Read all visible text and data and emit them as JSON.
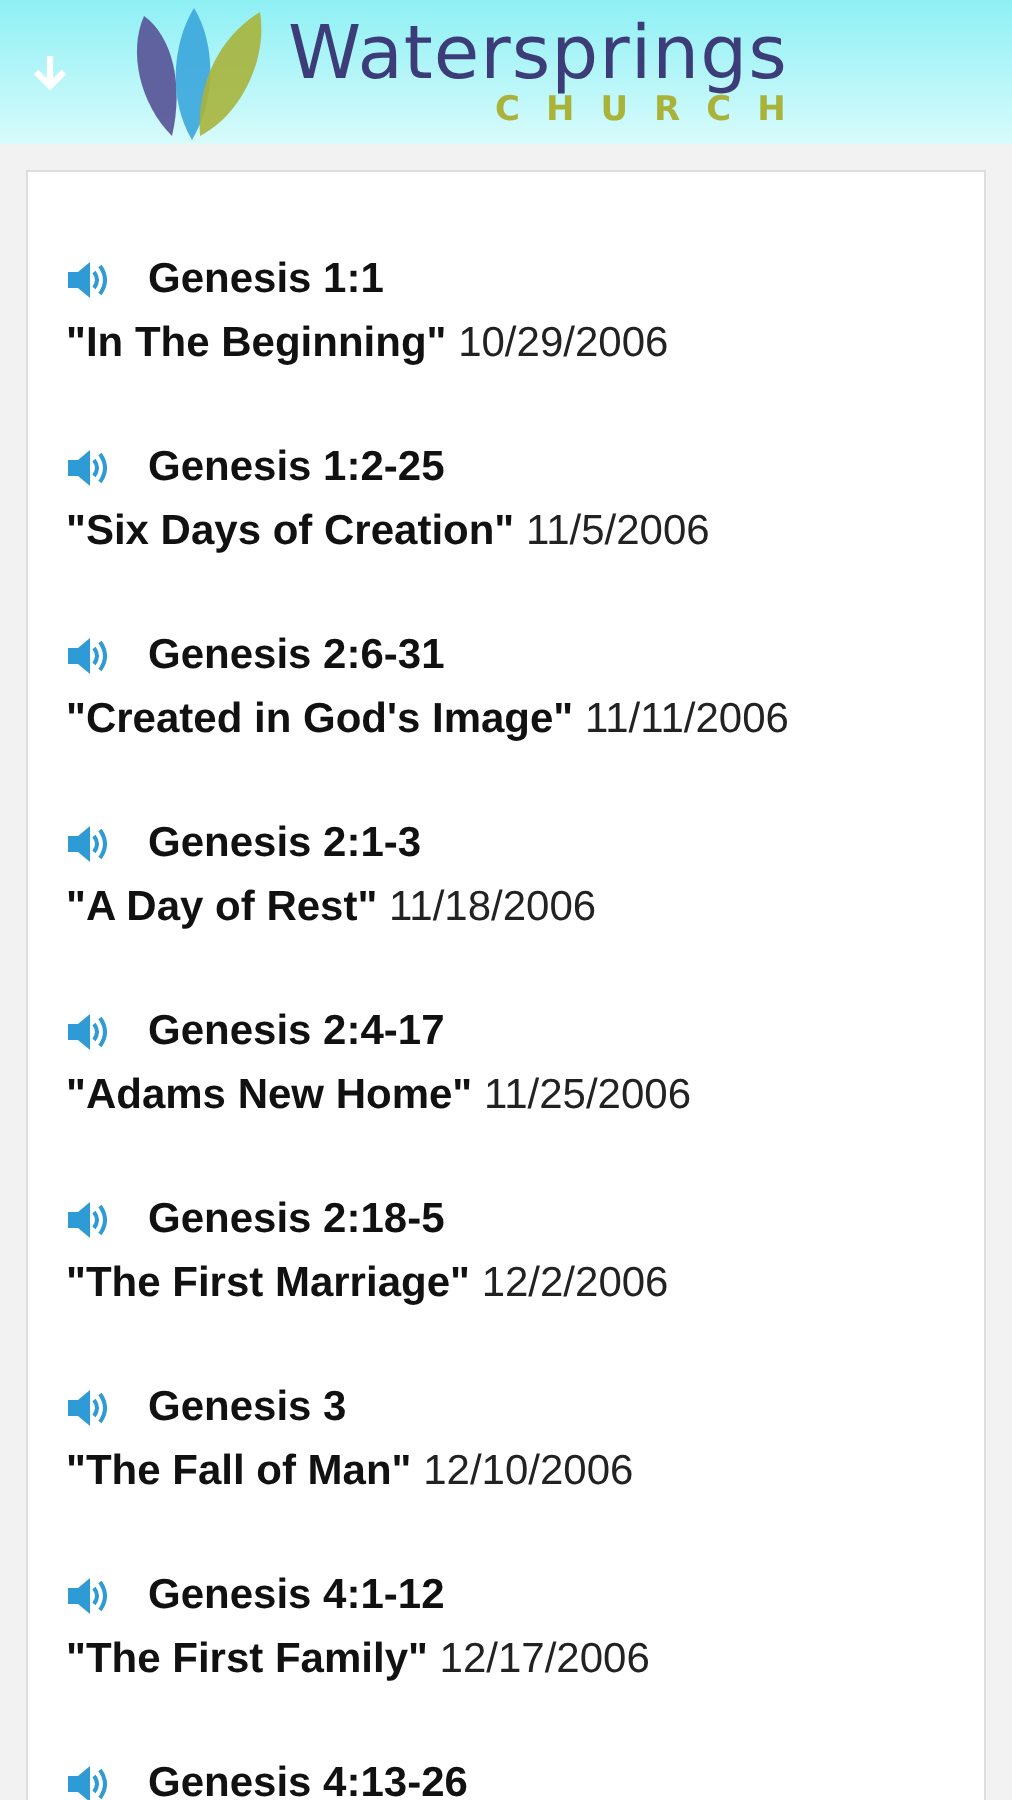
{
  "header": {
    "logo_title": "Watersprings",
    "logo_subtitle": "CHURCH"
  },
  "sermons": [
    {
      "reference": "Genesis 1:1",
      "title": "\"In The Beginning\"",
      "date": "10/29/2006"
    },
    {
      "reference": "Genesis 1:2-25",
      "title": "\"Six Days of Creation\"",
      "date": "11/5/2006"
    },
    {
      "reference": "Genesis 2:6-31",
      "title": "\"Created in God's Image\"",
      "date": "11/11/2006"
    },
    {
      "reference": "Genesis 2:1-3",
      "title": "\"A Day of Rest\"",
      "date": "11/18/2006"
    },
    {
      "reference": "Genesis 2:4-17",
      "title": "\"Adams New Home\"",
      "date": "11/25/2006"
    },
    {
      "reference": "Genesis 2:18-5",
      "title": "\"The First Marriage\"",
      "date": "12/2/2006"
    },
    {
      "reference": "Genesis 3",
      "title": "\"The Fall of Man\"",
      "date": "12/10/2006"
    },
    {
      "reference": "Genesis 4:1-12",
      "title": "\"The First Family\"",
      "date": "12/17/2006"
    },
    {
      "reference": "Genesis 4:13-26"
    }
  ]
}
